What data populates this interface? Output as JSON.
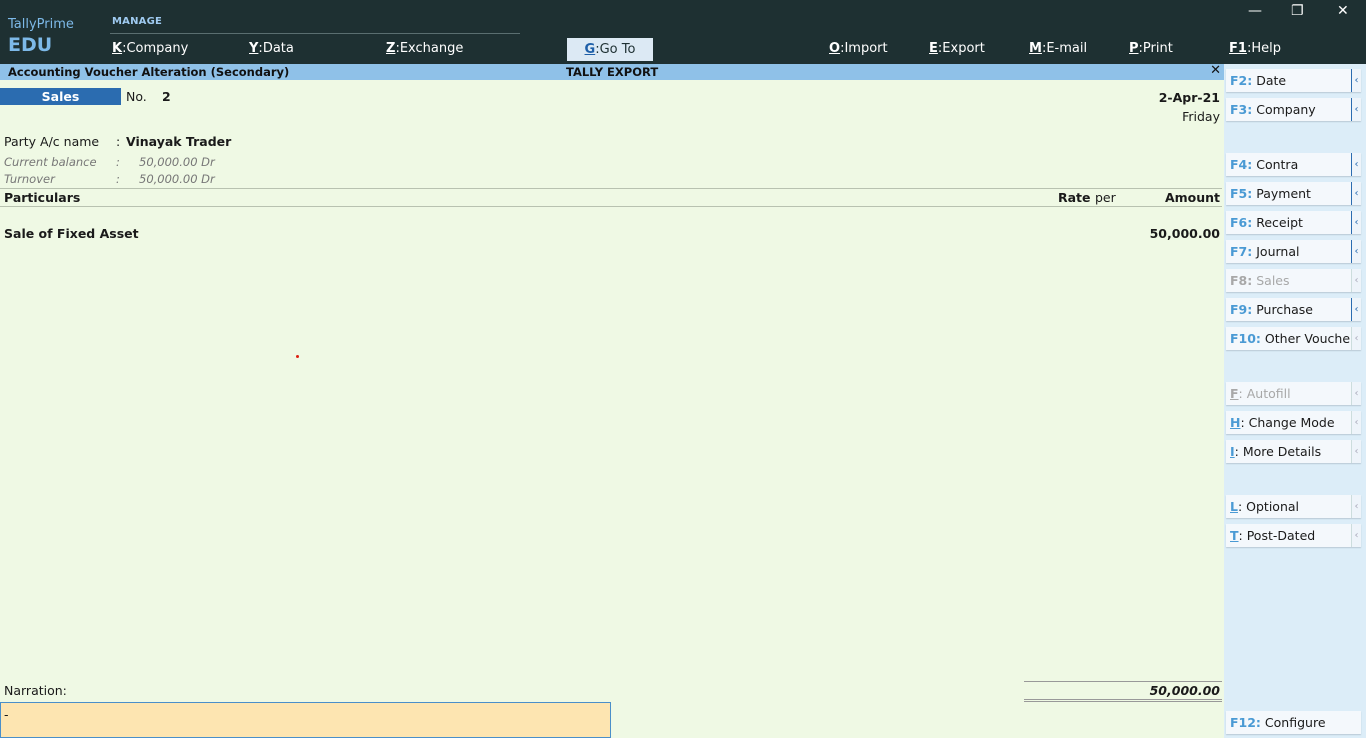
{
  "app": {
    "brand": "TallyPrime",
    "edition": "EDU",
    "section": "MANAGE"
  },
  "menu": [
    {
      "key": "K",
      "label": "Company"
    },
    {
      "key": "Y",
      "label": "Data"
    },
    {
      "key": "Z",
      "label": "Exchange"
    },
    {
      "key": "G",
      "label": "Go To"
    },
    {
      "key": "O",
      "label": "Import"
    },
    {
      "key": "E",
      "label": "Export"
    },
    {
      "key": "M",
      "label": "E-mail"
    },
    {
      "key": "P",
      "label": "Print"
    },
    {
      "key": "F1",
      "label": "Help"
    }
  ],
  "window_controls": {
    "minimize": "—",
    "restore": "❐",
    "close": "✕"
  },
  "titlebar": {
    "left": "Accounting Voucher Alteration (Secondary)",
    "center": "TALLY EXPORT",
    "close": "✕"
  },
  "voucher": {
    "type": "Sales",
    "no_label": "No.",
    "no": "2",
    "date": "2-Apr-21",
    "day": "Friday",
    "party_label": "Party A/c name",
    "party_colon": ":",
    "party": "Vinayak Trader",
    "curbal_label": "Current balance",
    "curbal_colon": ":",
    "curbal": "50,000.00 Dr",
    "turnover_label": "Turnover",
    "turnover_colon": ":",
    "turnover": "50,000.00 Dr"
  },
  "columns": {
    "particulars": "Particulars",
    "rate": "Rate",
    "per": "per",
    "amount": "Amount"
  },
  "rows": [
    {
      "name": "Sale of Fixed Asset",
      "amount": "50,000.00"
    }
  ],
  "narration": {
    "label": "Narration:",
    "value": "-"
  },
  "total": "50,000.00",
  "sidebar": [
    {
      "key": "F2:",
      "label": "Date"
    },
    {
      "key": "F3:",
      "label": "Company"
    },
    {
      "key": "F4:",
      "label": "Contra"
    },
    {
      "key": "F5:",
      "label": "Payment"
    },
    {
      "key": "F6:",
      "label": "Receipt"
    },
    {
      "key": "F7:",
      "label": "Journal"
    },
    {
      "key": "F8:",
      "label": "Sales"
    },
    {
      "key": "F9:",
      "label": "Purchase"
    },
    {
      "key": "F10:",
      "label": "Other Vouchers"
    },
    {
      "key": "F",
      "label": ": Autofill"
    },
    {
      "key": "H",
      "label": ": Change Mode"
    },
    {
      "key": "I",
      "label": ": More Details"
    },
    {
      "key": "L",
      "label": ": Optional"
    },
    {
      "key": "T",
      "label": ": Post-Dated"
    },
    {
      "key": "F12:",
      "label": "Configure"
    }
  ],
  "arrow_glyph": "‹"
}
